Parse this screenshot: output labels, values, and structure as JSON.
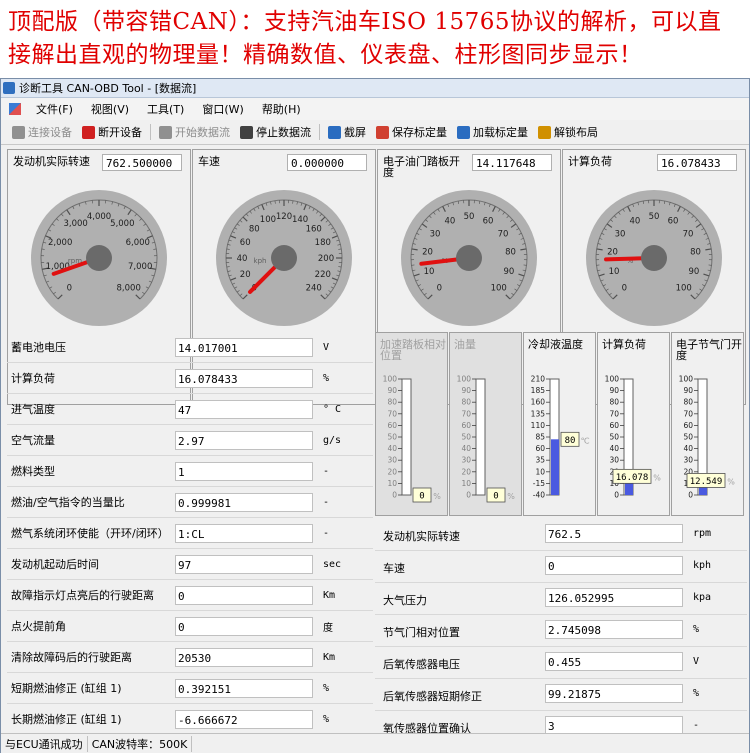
{
  "banner": {
    "line1": "顶配版（带容错CAN）：支持汽油车ISO 15765协议的解析，可以直",
    "line2": "接解出直观的物理量！精确数值、仪表盘、柱形图同步显示！"
  },
  "window": {
    "title": "诊断工具 CAN-OBD Tool - [数据流]"
  },
  "menu": [
    "文件(F)",
    "视图(V)",
    "工具(T)",
    "窗口(W)",
    "帮助(H)"
  ],
  "toolbar": [
    {
      "label": "连接设备",
      "icon": "plug-icon",
      "enabled": false,
      "color": "#909090"
    },
    {
      "label": "断开设备",
      "icon": "disconnect-icon",
      "enabled": true,
      "color": "#d02020"
    },
    {
      "label": "开始数据流",
      "icon": "play-icon",
      "enabled": false,
      "color": "#909090"
    },
    {
      "label": "停止数据流",
      "icon": "stop-icon",
      "enabled": true,
      "color": "#404040"
    },
    {
      "label": "截屏",
      "icon": "camera-icon",
      "enabled": true,
      "color": "#2a6cc0"
    },
    {
      "label": "保存标定量",
      "icon": "save-icon",
      "enabled": true,
      "color": "#d04030"
    },
    {
      "label": "加载标定量",
      "icon": "load-icon",
      "enabled": true,
      "color": "#2a6cc0"
    },
    {
      "label": "解锁布局",
      "icon": "lock-icon",
      "enabled": true,
      "color": "#d09000"
    }
  ],
  "gauges": [
    {
      "label": "发动机实际转速",
      "value": "762.500000",
      "unit": "rpm",
      "min": 0,
      "max": 8000,
      "reading": 762.5,
      "ticks": [
        "0",
        "1,000",
        "2,000",
        "3,000",
        "4,000",
        "5,000",
        "6,000",
        "7,000",
        "8,000"
      ]
    },
    {
      "label": "车速",
      "value": "0.000000",
      "unit": "kph",
      "min": 0,
      "max": 240,
      "reading": 0,
      "ticks": [
        "0",
        "20",
        "40",
        "60",
        "80",
        "100",
        "120",
        "140",
        "160",
        "180",
        "200",
        "220",
        "240"
      ]
    },
    {
      "label": "电子油门踏板开度",
      "value": "14.117648",
      "unit": "%",
      "min": 0,
      "max": 100,
      "reading": 14.117648,
      "ticks": [
        "0",
        "10",
        "20",
        "30",
        "40",
        "50",
        "60",
        "70",
        "80",
        "90",
        "100"
      ]
    },
    {
      "label": "计算负荷",
      "value": "16.078433",
      "unit": "%",
      "min": 0,
      "max": 100,
      "reading": 16.078433,
      "ticks": [
        "0",
        "10",
        "20",
        "30",
        "40",
        "50",
        "60",
        "70",
        "80",
        "90",
        "100"
      ]
    }
  ],
  "left_rows": [
    {
      "label": "蓄电池电压",
      "value": "14.017001",
      "unit": "V"
    },
    {
      "label": "计算负荷",
      "value": "16.078433",
      "unit": "%"
    },
    {
      "label": "进气温度",
      "value": "47",
      "unit": "° C"
    },
    {
      "label": "空气流量",
      "value": "2.97",
      "unit": "g/s"
    },
    {
      "label": "燃料类型",
      "value": "1",
      "unit": "-"
    },
    {
      "label": "燃油/空气指令的当量比",
      "value": "0.999981",
      "unit": "-"
    },
    {
      "label": "燃气系统闭环使能（开环/闭环）",
      "value": "1:CL",
      "unit": "-"
    },
    {
      "label": "发动机起动后时间",
      "value": "97",
      "unit": "sec"
    },
    {
      "label": "故障指示灯点亮后的行驶距离",
      "value": "0",
      "unit": "Km"
    },
    {
      "label": "点火提前角",
      "value": "0",
      "unit": "度"
    },
    {
      "label": "清除故障码后的行驶距离",
      "value": "20530",
      "unit": "Km"
    },
    {
      "label": "短期燃油修正 (缸组 1)",
      "value": "0.392151",
      "unit": "%"
    },
    {
      "label": "长期燃油修正 (缸组 1)",
      "value": "-6.666672",
      "unit": "%"
    }
  ],
  "bars": [
    {
      "label": "加速踏板相对位置",
      "dim": true,
      "min": 0,
      "max": 100,
      "reading": 0,
      "display": "0",
      "unit_glyph": "%",
      "ticks": [
        "100",
        "90",
        "80",
        "70",
        "60",
        "50",
        "40",
        "30",
        "20",
        "10",
        "0"
      ]
    },
    {
      "label": "油量",
      "dim": true,
      "min": 0,
      "max": 100,
      "reading": 0,
      "display": "0",
      "unit_glyph": "%",
      "ticks": [
        "100",
        "90",
        "80",
        "70",
        "60",
        "50",
        "40",
        "30",
        "20",
        "10",
        "0"
      ]
    },
    {
      "label": "冷却液温度",
      "dim": false,
      "min": -40,
      "max": 210,
      "reading": 80,
      "display": "80",
      "unit_glyph": "℃",
      "ticks": [
        "210",
        "185",
        "160",
        "135",
        "110",
        "85",
        "60",
        "35",
        "10",
        "-15",
        "-40"
      ]
    },
    {
      "label": "计算负荷",
      "dim": false,
      "min": 0,
      "max": 100,
      "reading": 16.078,
      "display": "16.078",
      "unit_glyph": "%",
      "ticks": [
        "100",
        "90",
        "80",
        "70",
        "60",
        "50",
        "40",
        "30",
        "20",
        "10",
        "0"
      ]
    },
    {
      "label": "电子节气门开度",
      "dim": false,
      "min": 0,
      "max": 100,
      "reading": 12.549,
      "display": "12.549",
      "unit_glyph": "%",
      "ticks": [
        "100",
        "90",
        "80",
        "70",
        "60",
        "50",
        "40",
        "30",
        "20",
        "10",
        "0"
      ]
    }
  ],
  "right_rows": [
    {
      "label": "发动机实际转速",
      "value": "762.5",
      "unit": "rpm"
    },
    {
      "label": "车速",
      "value": "0",
      "unit": "kph"
    },
    {
      "label": "大气压力",
      "value": "126.052995",
      "unit": "kpa"
    },
    {
      "label": "节气门相对位置",
      "value": "2.745098",
      "unit": "%"
    },
    {
      "label": "后氧传感器电压",
      "value": "0.455",
      "unit": "V"
    },
    {
      "label": "后氧传感器短期修正",
      "value": "99.21875",
      "unit": "%"
    },
    {
      "label": "氧传感器位置确认",
      "value": "3",
      "unit": "-"
    }
  ],
  "status": [
    "与ECU通讯成功",
    "CAN波特率：500K"
  ],
  "colors": {
    "needle": "#e01010",
    "bar_fill": "#4a5ae0",
    "banner": "#e00000"
  }
}
